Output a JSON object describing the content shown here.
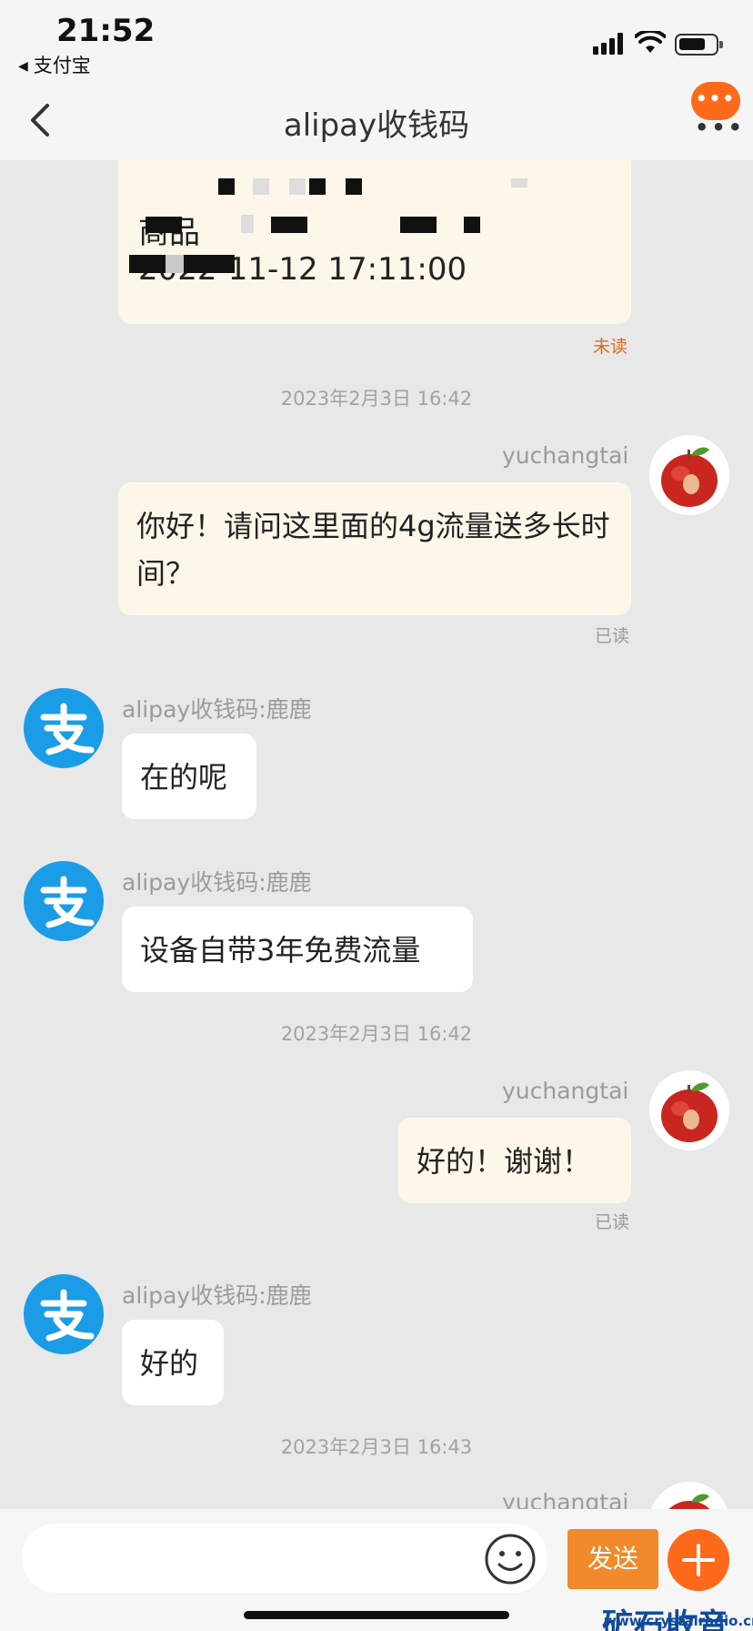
{
  "status_bar": {
    "time": "21:52",
    "back_app": "支付宝",
    "back_glyph": "◀"
  },
  "nav": {
    "title": "alipay收钱码",
    "back_icon": "chevron-left-icon",
    "more_icon": "more-dots-icon"
  },
  "order_card": {
    "line1": "商品",
    "line2": "2022-11-12 17:11:00",
    "status": "未读"
  },
  "messages": [
    {
      "type": "time",
      "text": "2023年2月3日 16:42"
    },
    {
      "type": "mine",
      "sender": "yuchangtai",
      "text": "你好！请问这里面的4g流量送多长时间？",
      "status": "已读"
    },
    {
      "type": "theirs",
      "sender": "alipay收钱码:鹿鹿",
      "text": "在的呢"
    },
    {
      "type": "theirs",
      "sender": "alipay收钱码:鹿鹿",
      "text": "设备自带3年免费流量"
    },
    {
      "type": "time",
      "text": "2023年2月3日 16:42"
    },
    {
      "type": "mine",
      "sender": "yuchangtai",
      "text": "好的！谢谢！",
      "status": "已读"
    },
    {
      "type": "theirs",
      "sender": "alipay收钱码:鹿鹿",
      "text": "好的"
    },
    {
      "type": "time",
      "text": "2023年2月3日 16:43"
    },
    {
      "type": "mine-partial",
      "sender": "yuchangtai"
    }
  ],
  "input_bar": {
    "placeholder": "",
    "send_label": "发送",
    "emoji_icon": "smiley-icon",
    "plus_icon": "plus-icon"
  },
  "watermark": {
    "title": "矿石收音机",
    "url": "www.crystalradio.cn"
  },
  "colors": {
    "accent": "#ff6a1a",
    "mine_bubble": "#fcf7e8",
    "theirs_bubble": "#ffffff",
    "unread": "#e2671d",
    "alipay_blue": "#1b9ce6"
  }
}
